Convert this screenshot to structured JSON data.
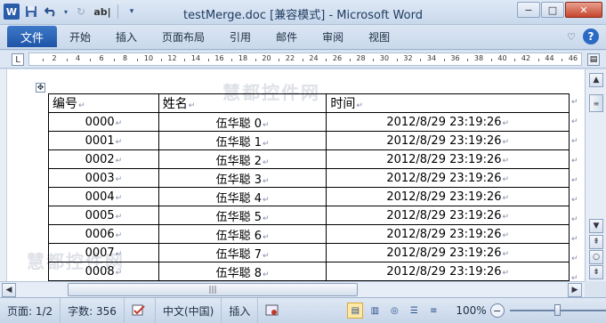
{
  "window": {
    "title": "testMerge.doc [兼容模式] - Microsoft Word",
    "app_icon": "W",
    "minimize": "−",
    "maximize": "□",
    "close": "✕"
  },
  "qat": {
    "save_icon": "save-icon",
    "undo_icon": "undo-icon",
    "redo_icon": "redo-icon",
    "format_label": "ab|"
  },
  "ribbon": {
    "file_tab": "文件",
    "tabs": [
      "开始",
      "插入",
      "页面布局",
      "引用",
      "邮件",
      "审阅",
      "视图"
    ],
    "help": "?"
  },
  "ruler": {
    "ticks": [
      "2",
      "4",
      "6",
      "8",
      "10",
      "12",
      "14",
      "16",
      "18",
      "20",
      "22",
      "24",
      "26",
      "28",
      "30",
      "32",
      "34",
      "36",
      "38",
      "40",
      "42",
      "44",
      "46"
    ]
  },
  "table": {
    "headers": [
      "编号",
      "姓名",
      "时间"
    ],
    "rows": [
      {
        "id": "0000",
        "name": "伍华聪  0",
        "time": "2012/8/29  23:19:26"
      },
      {
        "id": "0001",
        "name": "伍华聪  1",
        "time": "2012/8/29  23:19:26"
      },
      {
        "id": "0002",
        "name": "伍华聪  2",
        "time": "2012/8/29  23:19:26"
      },
      {
        "id": "0003",
        "name": "伍华聪  3",
        "time": "2012/8/29  23:19:26"
      },
      {
        "id": "0004",
        "name": "伍华聪  4",
        "time": "2012/8/29  23:19:26"
      },
      {
        "id": "0005",
        "name": "伍华聪  5",
        "time": "2012/8/29  23:19:26"
      },
      {
        "id": "0006",
        "name": "伍华聪  6",
        "time": "2012/8/29  23:19:26"
      },
      {
        "id": "0007",
        "name": "伍华聪  7",
        "time": "2012/8/29  23:19:26"
      },
      {
        "id": "0008",
        "name": "伍华聪  8",
        "time": "2012/8/29  23:19:26"
      }
    ]
  },
  "watermark": "慧都控件网",
  "status": {
    "page": "页面: 1/2",
    "words": "字数: 356",
    "language": "中文(中国)",
    "mode": "插入",
    "zoom": "100%",
    "zoom_level": 1.0
  }
}
